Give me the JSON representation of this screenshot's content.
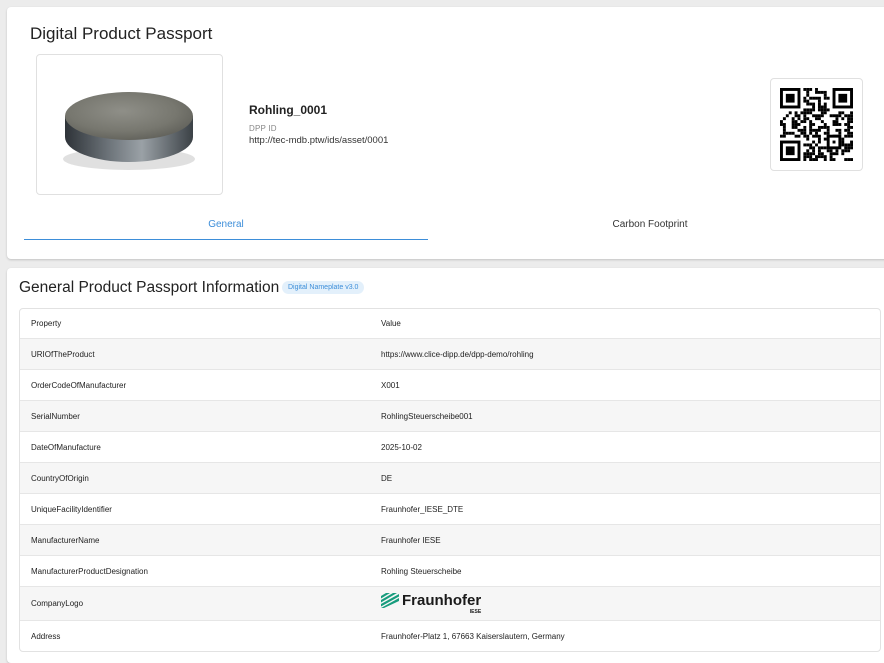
{
  "header": {
    "title": "Digital Product Passport",
    "product_name": "Rohling_0001",
    "dpp_id_label": "DPP ID",
    "dpp_id_value": "http://tec-mdb.ptw/ids/asset/0001"
  },
  "tabs": [
    {
      "label": "General",
      "active": true
    },
    {
      "label": "Carbon Footprint",
      "active": false
    }
  ],
  "section": {
    "title": "General Product Passport Information",
    "badge": "Digital Nameplate v3.0"
  },
  "table": {
    "headers": [
      "Property",
      "Value"
    ],
    "rows": [
      {
        "property": "URIOfTheProduct",
        "value": "https://www.clice-dipp.de/dpp-demo/rohling"
      },
      {
        "property": "OrderCodeOfManufacturer",
        "value": "X001"
      },
      {
        "property": "SerialNumber",
        "value": "RohlingSteuerscheibe001"
      },
      {
        "property": "DateOfManufacture",
        "value": "2025-10-02"
      },
      {
        "property": "CountryOfOrigin",
        "value": "DE"
      },
      {
        "property": "UniqueFacilityIdentifier",
        "value": "Fraunhofer_IESE_DTE"
      },
      {
        "property": "ManufacturerName",
        "value": "Fraunhofer IESE"
      },
      {
        "property": "ManufacturerProductDesignation",
        "value": "Rohling Steuerscheibe"
      },
      {
        "property": "CompanyLogo",
        "value": "",
        "logo_text": "Fraunhofer",
        "logo_sub": "IESE"
      },
      {
        "property": "Address",
        "value": "Fraunhofer-Platz 1, 67663 Kaiserslautern, Germany"
      }
    ]
  },
  "colors": {
    "accent": "#3d8ed9",
    "logo_green": "#179c7d"
  },
  "icons": {
    "qr": "qr-code",
    "logo": "fraunhofer-logo-mark"
  }
}
